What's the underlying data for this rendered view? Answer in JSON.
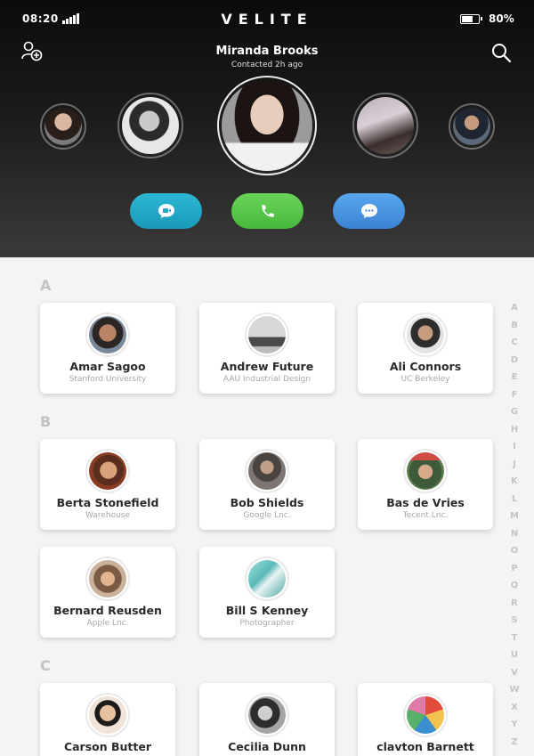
{
  "status": {
    "time": "08:20",
    "brand": "VELITE",
    "battery": "80%",
    "battery_level": 0.8
  },
  "header": {
    "featured": {
      "name": "Miranda Brooks",
      "subtitle": "Contacted 2h ago"
    },
    "add_icon": "add-user-icon",
    "search_icon": "search-icon",
    "actions": {
      "video": "video-chat-icon",
      "call": "phone-icon",
      "message": "chat-bubble-icon"
    }
  },
  "sections": [
    {
      "letter": "A",
      "contacts": [
        {
          "name": "Amar Sagoo",
          "subtitle": "Stanford University"
        },
        {
          "name": "Andrew Future",
          "subtitle": "AAU Industrial Design"
        },
        {
          "name": "Ali Connors",
          "subtitle": "UC Berkeley"
        }
      ]
    },
    {
      "letter": "B",
      "contacts": [
        {
          "name": "Berta Stonefield",
          "subtitle": "Warehouse"
        },
        {
          "name": "Bob Shields",
          "subtitle": "Google Lnc."
        },
        {
          "name": "Bas de Vries",
          "subtitle": "Tecent Lnc."
        },
        {
          "name": "Bernard Reusden",
          "subtitle": "Apple Lnc."
        },
        {
          "name": "Bill S Kenney",
          "subtitle": "Photographer"
        }
      ]
    },
    {
      "letter": "C",
      "contacts": [
        {
          "name": "Carson Butter",
          "subtitle": ""
        },
        {
          "name": "Cecilia Dunn",
          "subtitle": ""
        },
        {
          "name": "clavton Barnett",
          "subtitle": ""
        }
      ]
    }
  ],
  "alphabet": [
    "A",
    "B",
    "C",
    "D",
    "E",
    "F",
    "G",
    "H",
    "I",
    "J",
    "K",
    "L",
    "M",
    "N",
    "O",
    "P",
    "Q",
    "R",
    "S",
    "T",
    "U",
    "V",
    "W",
    "X",
    "Y",
    "Z"
  ],
  "colors": {
    "video": "#1fa8c6",
    "call": "#55c447",
    "message": "#4a93e0",
    "section_letter": "#c2c2c2"
  }
}
